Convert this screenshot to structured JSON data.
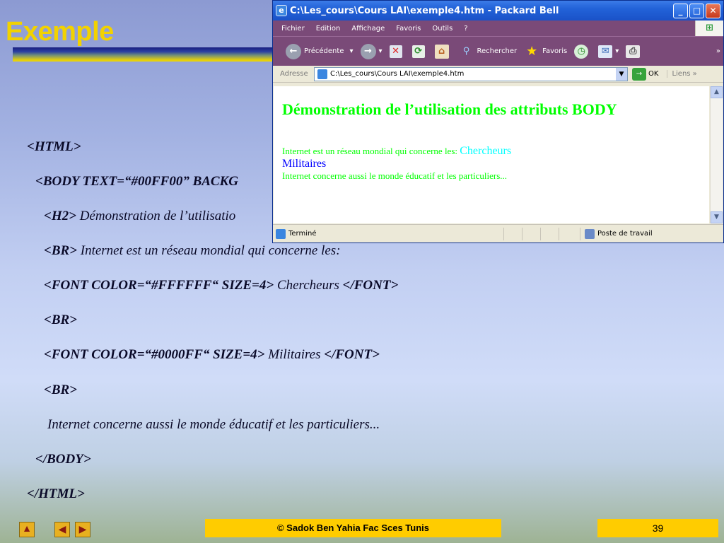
{
  "slide": {
    "title": "Exemple",
    "code_lines": [
      {
        "tag": "<HTML>",
        "text": ""
      },
      {
        "tag": "<BODY TEXT=“#00FF00” BACKG",
        "text": ""
      },
      {
        "tag": "<H2>",
        "text": " Démonstration de l’utilisatio"
      },
      {
        "tag": "<BR>",
        "text": " Internet est un réseau mondial qui concerne les:"
      },
      {
        "tag": "<FONT COLOR=“#FFFFFF“ SIZE=4>",
        "text": " Chercheurs ",
        "tag_end": "</FONT>"
      },
      {
        "tag": "<BR>",
        "text": ""
      },
      {
        "tag": "<FONT COLOR=“#0000FF“ SIZE=4>",
        "text": " Militaires ",
        "tag_end": "</FONT>"
      },
      {
        "tag": "<BR>",
        "text": ""
      },
      {
        "tag": "",
        "text": "Internet concerne aussi le monde éducatif et les particuliers..."
      },
      {
        "tag": "</BODY>",
        "text": ""
      },
      {
        "tag": "</HTML>",
        "text": ""
      }
    ]
  },
  "browser": {
    "title": "C:\\Les_cours\\Cours LAI\\exemple4.htm - Packard Bell",
    "menu": [
      "Fichier",
      "Edition",
      "Affichage",
      "Favoris",
      "Outils",
      "?"
    ],
    "toolbar": {
      "back_label": "Précédente",
      "search_label": "Rechercher",
      "favorites_label": "Favoris"
    },
    "address": {
      "label": "Adresse",
      "value": "C:\\Les_cours\\Cours LAI\\exemple4.htm",
      "go_label": "OK",
      "links_label": "Liens"
    },
    "page": {
      "heading": "Démonstration de l’utilisation des attributs BODY",
      "line1": "Internet est un réseau mondial qui concerne les: ",
      "chercheurs": "Chercheurs",
      "militaires": "Militaires",
      "line3": "Internet concerne aussi le monde éducatif et les particuliers..."
    },
    "status": {
      "text": "Terminé",
      "zone": "Poste de travail"
    }
  },
  "footer": {
    "copyright": "© Sadok Ben Yahia Fac Sces Tunis",
    "page_number": "39"
  },
  "colors": {
    "title": "#f2d200",
    "footer_bg": "#ffcc00",
    "page_text": "#00ff00",
    "chercheurs": "#00ffff",
    "militaires": "#0000ff"
  }
}
